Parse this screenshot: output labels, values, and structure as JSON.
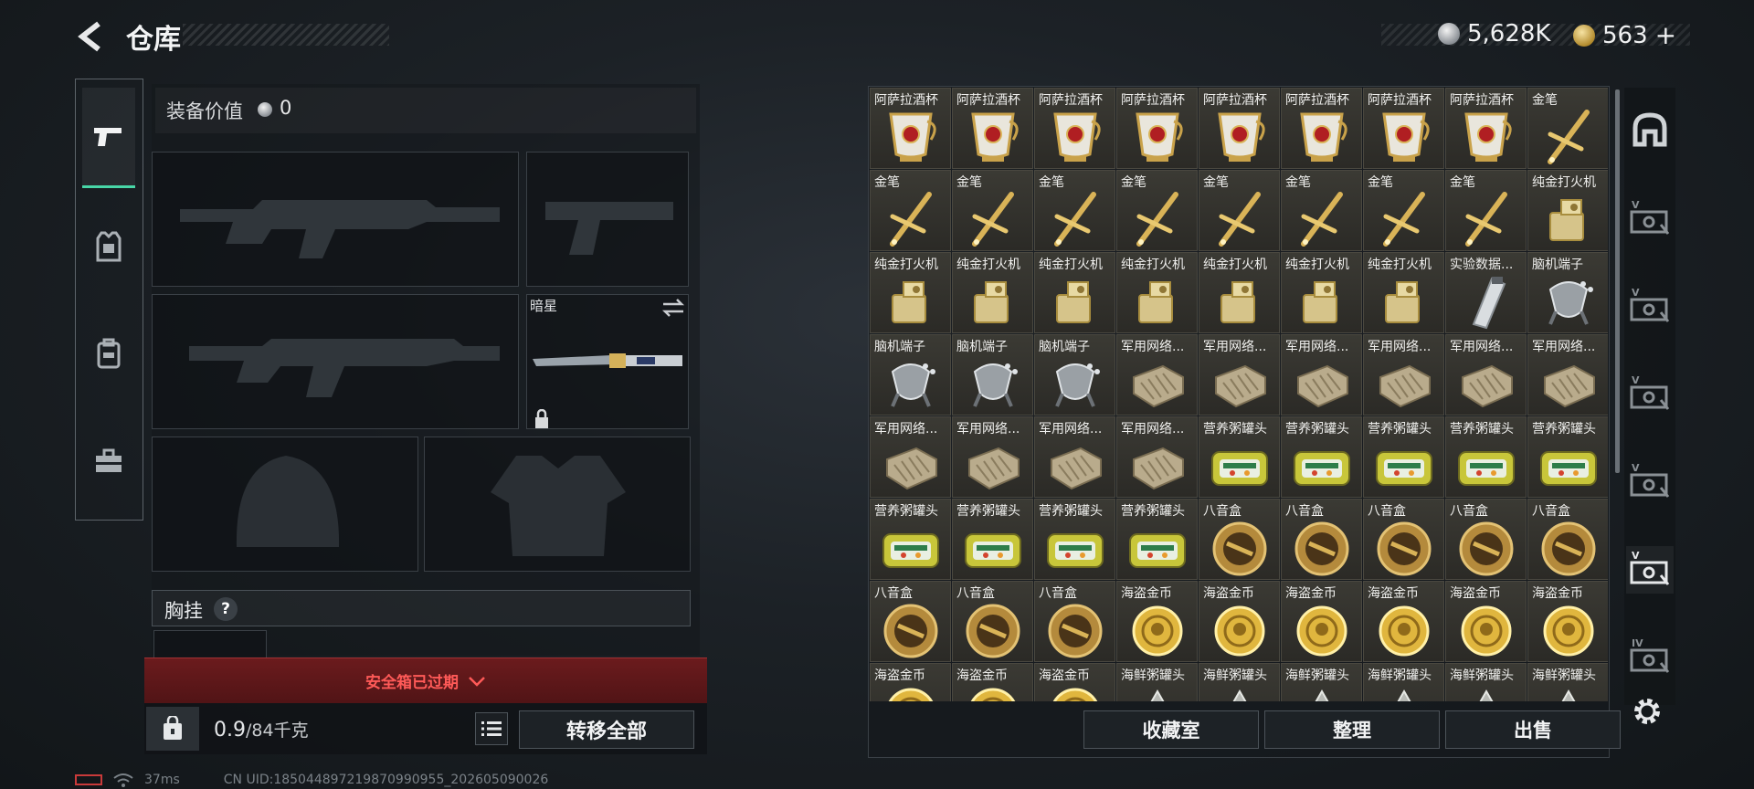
{
  "header": {
    "title": "仓库",
    "silver_amount": "5,628K",
    "gold_amount": "563",
    "gold_add": "+"
  },
  "equipment": {
    "value_label": "装备价值",
    "value_amount": "0",
    "knife_name": "暗星",
    "chest_label": "胸挂",
    "chest_help": "?"
  },
  "safebox": {
    "expired_label": "安全箱已过期"
  },
  "weight": {
    "current": "0.9",
    "max": "/84千克",
    "transfer_all": "转移全部"
  },
  "status": {
    "ping": "37ms",
    "uid": "CN UID:18504489721987099095​5_202605090026"
  },
  "inventory": {
    "items": [
      {
        "name": "阿萨拉酒杯",
        "art": "cup"
      },
      {
        "name": "阿萨拉酒杯",
        "art": "cup"
      },
      {
        "name": "阿萨拉酒杯",
        "art": "cup"
      },
      {
        "name": "阿萨拉酒杯",
        "art": "cup"
      },
      {
        "name": "阿萨拉酒杯",
        "art": "cup"
      },
      {
        "name": "阿萨拉酒杯",
        "art": "cup"
      },
      {
        "name": "阿萨拉酒杯",
        "art": "cup"
      },
      {
        "name": "阿萨拉酒杯",
        "art": "cup"
      },
      {
        "name": "金笔",
        "art": "pen"
      },
      {
        "name": "金笔",
        "art": "pen"
      },
      {
        "name": "金笔",
        "art": "pen"
      },
      {
        "name": "金笔",
        "art": "pen"
      },
      {
        "name": "金笔",
        "art": "pen"
      },
      {
        "name": "金笔",
        "art": "pen"
      },
      {
        "name": "金笔",
        "art": "pen"
      },
      {
        "name": "金笔",
        "art": "pen"
      },
      {
        "name": "金笔",
        "art": "pen"
      },
      {
        "name": "纯金打火机",
        "art": "lighter"
      },
      {
        "name": "纯金打火机",
        "art": "lighter"
      },
      {
        "name": "纯金打火机",
        "art": "lighter"
      },
      {
        "name": "纯金打火机",
        "art": "lighter"
      },
      {
        "name": "纯金打火机",
        "art": "lighter"
      },
      {
        "name": "纯金打火机",
        "art": "lighter"
      },
      {
        "name": "纯金打火机",
        "art": "lighter"
      },
      {
        "name": "纯金打火机",
        "art": "lighter"
      },
      {
        "name": "实验数据...",
        "art": "drive"
      },
      {
        "name": "脑机端子",
        "art": "brain"
      },
      {
        "name": "脑机端子",
        "art": "brain"
      },
      {
        "name": "脑机端子",
        "art": "brain"
      },
      {
        "name": "脑机端子",
        "art": "brain"
      },
      {
        "name": "军用网络...",
        "art": "net"
      },
      {
        "name": "军用网络...",
        "art": "net"
      },
      {
        "name": "军用网络...",
        "art": "net"
      },
      {
        "name": "军用网络...",
        "art": "net"
      },
      {
        "name": "军用网络...",
        "art": "net"
      },
      {
        "name": "军用网络...",
        "art": "net"
      },
      {
        "name": "军用网络...",
        "art": "net"
      },
      {
        "name": "军用网络...",
        "art": "net"
      },
      {
        "name": "军用网络...",
        "art": "net"
      },
      {
        "name": "军用网络...",
        "art": "net"
      },
      {
        "name": "营养粥罐头",
        "art": "tin"
      },
      {
        "name": "营养粥罐头",
        "art": "tin"
      },
      {
        "name": "营养粥罐头",
        "art": "tin"
      },
      {
        "name": "营养粥罐头",
        "art": "tin"
      },
      {
        "name": "营养粥罐头",
        "art": "tin"
      },
      {
        "name": "营养粥罐头",
        "art": "tin"
      },
      {
        "name": "营养粥罐头",
        "art": "tin"
      },
      {
        "name": "营养粥罐头",
        "art": "tin"
      },
      {
        "name": "营养粥罐头",
        "art": "tin"
      },
      {
        "name": "八音盒",
        "art": "musicbox"
      },
      {
        "name": "八音盒",
        "art": "musicbox"
      },
      {
        "name": "八音盒",
        "art": "musicbox"
      },
      {
        "name": "八音盒",
        "art": "musicbox"
      },
      {
        "name": "八音盒",
        "art": "musicbox"
      },
      {
        "name": "八音盒",
        "art": "musicbox"
      },
      {
        "name": "八音盒",
        "art": "musicbox"
      },
      {
        "name": "八音盒",
        "art": "musicbox"
      },
      {
        "name": "海盗金币",
        "art": "coin"
      },
      {
        "name": "海盗金币",
        "art": "coin"
      },
      {
        "name": "海盗金币",
        "art": "coin"
      },
      {
        "name": "海盗金币",
        "art": "coin"
      },
      {
        "name": "海盗金币",
        "art": "coin"
      },
      {
        "name": "海盗金币",
        "art": "coin"
      },
      {
        "name": "海盗金币",
        "art": "coin"
      },
      {
        "name": "海盗金币",
        "art": "coin"
      },
      {
        "name": "海盗金币",
        "art": "coin"
      },
      {
        "name": "海鲜粥罐头",
        "art": "seafood"
      },
      {
        "name": "海鲜粥罐头",
        "art": "seafood"
      },
      {
        "name": "海鲜粥罐头",
        "art": "seafood"
      },
      {
        "name": "海鲜粥罐头",
        "art": "seafood"
      },
      {
        "name": "海鲜粥罐头",
        "art": "seafood"
      },
      {
        "name": "海鲜粥罐头",
        "art": "seafood"
      }
    ],
    "buttons": {
      "collection": "收藏室",
      "organize": "整理",
      "sell": "出售"
    }
  },
  "right_rail": {
    "labels": [
      "V",
      "V",
      "V",
      "V",
      "V",
      "IV"
    ]
  }
}
